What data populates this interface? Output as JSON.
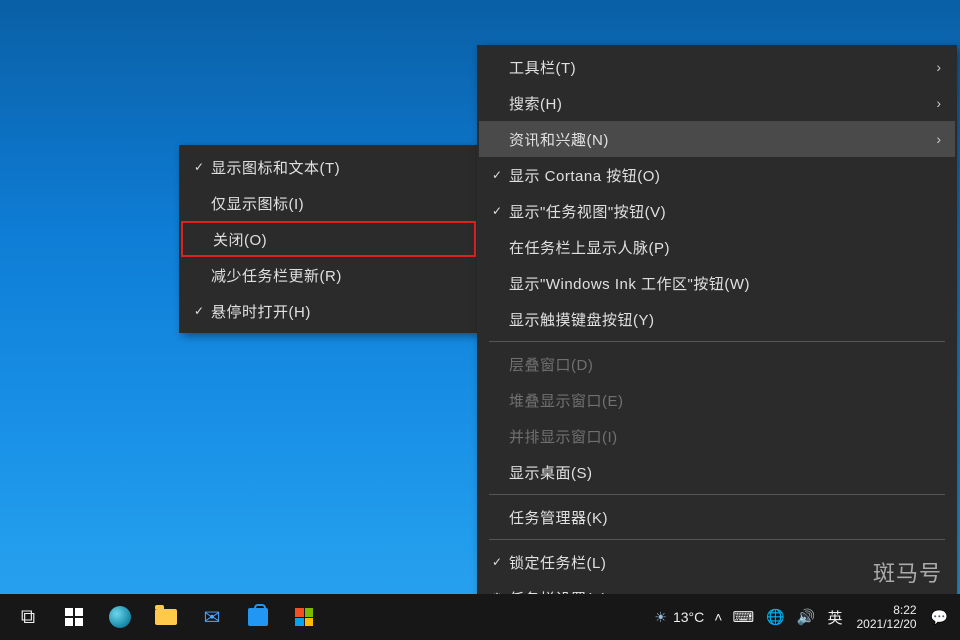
{
  "submenu": {
    "items": [
      {
        "label": "显示图标和文本(T)",
        "checked": true
      },
      {
        "label": "仅显示图标(I)",
        "checked": false
      },
      {
        "label": "关闭(O)",
        "checked": false,
        "boxed": true
      },
      {
        "label": "减少任务栏更新(R)",
        "checked": false
      },
      {
        "label": "悬停时打开(H)",
        "checked": true
      }
    ]
  },
  "mainmenu": {
    "groups": [
      [
        {
          "label": "工具栏(T)",
          "checked": false,
          "arrow": true
        },
        {
          "label": "搜索(H)",
          "checked": false,
          "arrow": true
        },
        {
          "label": "资讯和兴趣(N)",
          "checked": false,
          "arrow": true,
          "highlighted": true
        },
        {
          "label": "显示 Cortana 按钮(O)",
          "checked": true
        },
        {
          "label": "显示\"任务视图\"按钮(V)",
          "checked": true
        },
        {
          "label": "在任务栏上显示人脉(P)",
          "checked": false
        },
        {
          "label": "显示\"Windows Ink 工作区\"按钮(W)",
          "checked": false
        },
        {
          "label": "显示触摸键盘按钮(Y)",
          "checked": false
        }
      ],
      [
        {
          "label": "层叠窗口(D)",
          "disabled": true
        },
        {
          "label": "堆叠显示窗口(E)",
          "disabled": true
        },
        {
          "label": "并排显示窗口(I)",
          "disabled": true
        },
        {
          "label": "显示桌面(S)"
        }
      ],
      [
        {
          "label": "任务管理器(K)"
        }
      ],
      [
        {
          "label": "锁定任务栏(L)",
          "checked": true
        },
        {
          "label": "任务栏设置(T)",
          "gear": true
        }
      ]
    ]
  },
  "taskbar": {
    "weather_temp": "13°C",
    "ime": "英",
    "time": "8:22",
    "date": "2021/12/20"
  },
  "watermark": "斑马号"
}
